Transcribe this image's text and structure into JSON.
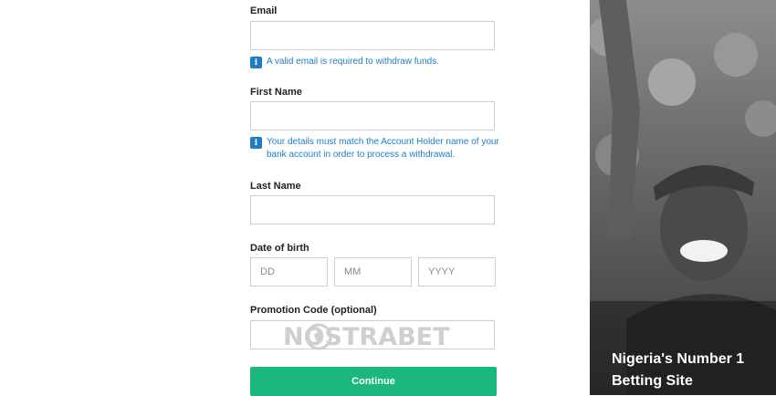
{
  "email": {
    "label": "Email",
    "value": "",
    "info": "A valid email is required to withdraw funds."
  },
  "first_name": {
    "label": "First Name",
    "value": "",
    "info": "Your details must match the Account Holder name of your bank account in order to process a withdrawal."
  },
  "last_name": {
    "label": "Last Name",
    "value": ""
  },
  "dob": {
    "label": "Date of birth",
    "dd_placeholder": "DD",
    "mm_placeholder": "MM",
    "yyyy_placeholder": "YYYY"
  },
  "promo": {
    "label": "Promotion Code (optional)",
    "value": ""
  },
  "watermark": {
    "text": "NOSTRABET"
  },
  "continue_label": "Continue",
  "hero": {
    "tagline": "Nigeria's Number 1 Betting Site"
  },
  "colors": {
    "accent": "#1bb77d",
    "info": "#1f7ec2"
  },
  "icons": {
    "info": "info-icon"
  }
}
